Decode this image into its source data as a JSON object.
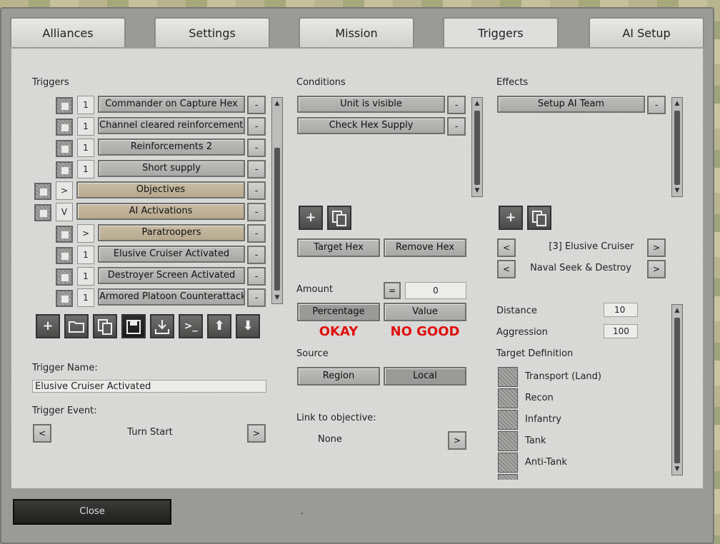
{
  "tabs": [
    {
      "label": "Alliances"
    },
    {
      "label": "Settings"
    },
    {
      "label": "Mission"
    },
    {
      "label": "Triggers"
    },
    {
      "label": "AI Setup"
    }
  ],
  "active_tab": "Triggers",
  "triggers": {
    "header": "Triggers",
    "items": [
      {
        "num": "1",
        "label": "Commander on Capture Hex",
        "btn": "-"
      },
      {
        "num": "1",
        "label": "Channel cleared reinforcements",
        "btn": "-"
      },
      {
        "num": "1",
        "label": "Reinforcements 2",
        "btn": "-"
      },
      {
        "num": "1",
        "label": "Short supply",
        "btn": "-"
      },
      {
        "num": ">",
        "label": "Objectives",
        "btn": "-"
      },
      {
        "num": "V",
        "label": "AI Activations",
        "btn": "-"
      },
      {
        "num": ">",
        "label": "Paratroopers",
        "btn": "-"
      },
      {
        "num": "1",
        "label": "Elusive Cruiser Activated",
        "btn": "-"
      },
      {
        "num": "1",
        "label": "Destroyer Screen Activated",
        "btn": "-"
      },
      {
        "num": "1",
        "label": "Armored Platoon Counterattack",
        "btn": "-"
      }
    ],
    "toolbar_icons": [
      "plus-icon",
      "folder-icon",
      "copy-icon",
      "save-icon",
      "import-icon",
      "console-icon",
      "arrow-up-icon",
      "arrow-down-icon"
    ],
    "name_label": "Trigger Name:",
    "name_value": "Elusive Cruiser Activated",
    "event_label": "Trigger Event:",
    "event_value": "Turn Start",
    "prev": "<",
    "next": ">"
  },
  "conditions": {
    "header": "Conditions",
    "items": [
      {
        "label": "Unit is visible",
        "btn": "-"
      },
      {
        "label": "Check Hex Supply",
        "btn": "-"
      }
    ],
    "target_hex": "Target Hex",
    "remove_hex": "Remove Hex",
    "amount_label": "Amount",
    "amount_op": "=",
    "amount_value": "0",
    "percentage": "Percentage",
    "value": "Value",
    "okay": "OKAY",
    "no_good": "NO GOOD",
    "source_label": "Source",
    "region": "Region",
    "local": "Local",
    "link_label": "Link to objective:",
    "link_value": "None",
    "link_next": ">"
  },
  "effects": {
    "header": "Effects",
    "items": [
      {
        "label": "Setup AI Team",
        "btn": "-"
      }
    ],
    "team_value": "[3] Elusive Cruiser",
    "mode_value": "Naval Seek & Destroy",
    "prev": "<",
    "next": ">",
    "distance_label": "Distance",
    "distance_value": "10",
    "aggression_label": "Aggression",
    "aggression_value": "100",
    "target_label": "Target Definition",
    "targets": [
      {
        "label": "Transport (Land)"
      },
      {
        "label": "Recon"
      },
      {
        "label": "Infantry"
      },
      {
        "label": "Tank"
      },
      {
        "label": "Anti-Tank"
      }
    ]
  },
  "close_label": "Close",
  "footer_mark": "-"
}
